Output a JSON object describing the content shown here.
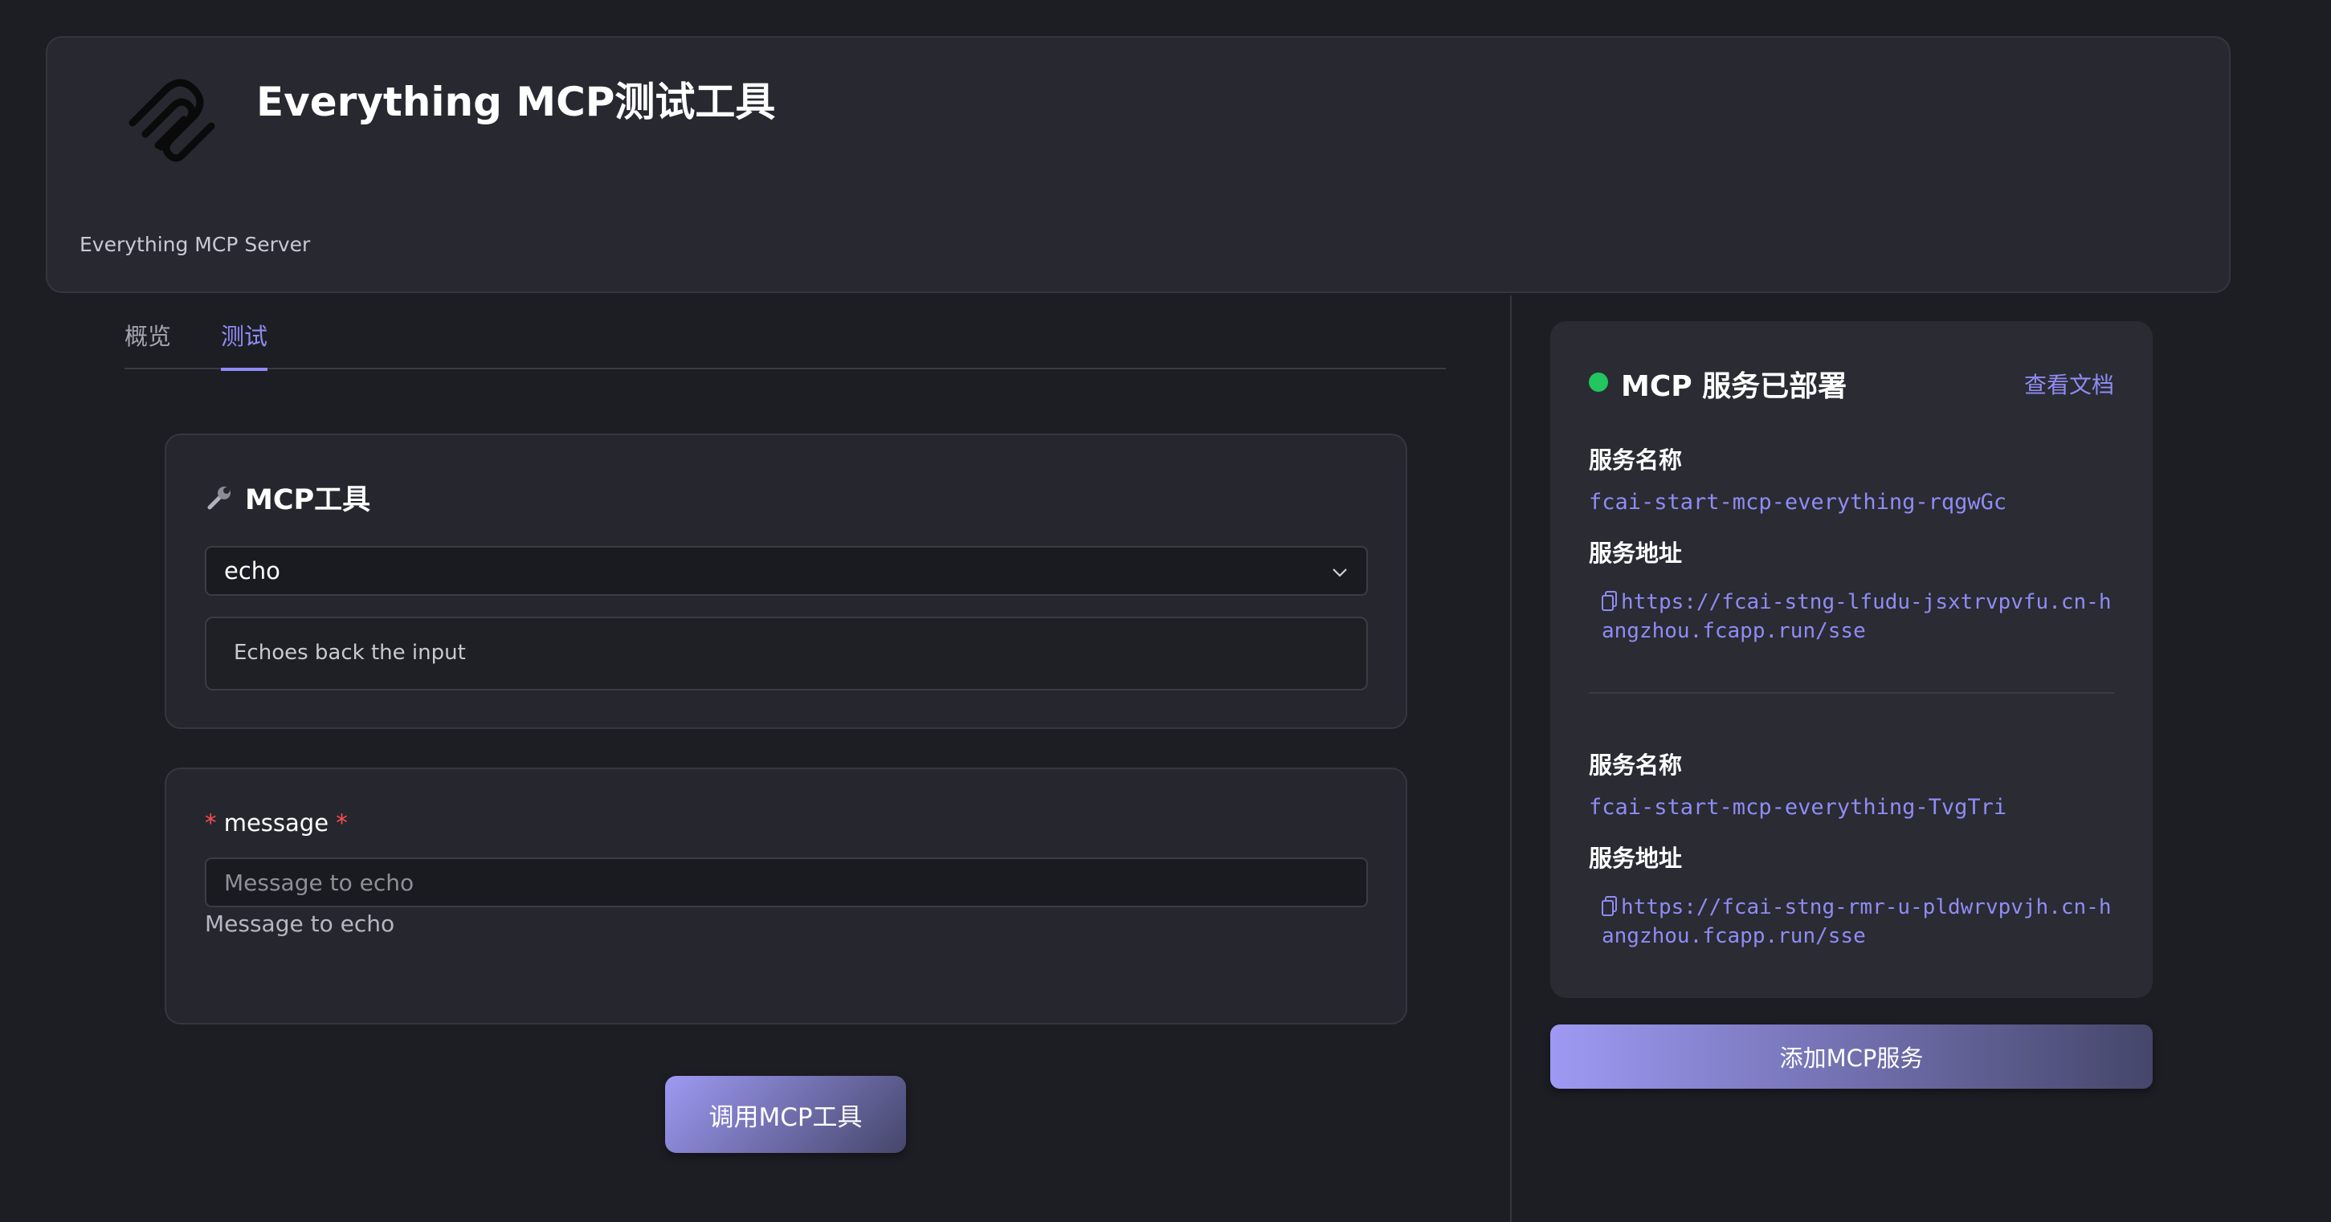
{
  "header": {
    "title": "Everything MCP测试工具",
    "server_label": "Everything MCP Server",
    "logo_icon": "mcp-logo-icon"
  },
  "tabs": [
    {
      "label": "概览",
      "active": false
    },
    {
      "label": "测试",
      "active": true
    }
  ],
  "tool_panel": {
    "title": "MCP工具",
    "title_icon": "wrench-icon",
    "selected_tool": "echo",
    "description": "Echoes back the input"
  },
  "params": {
    "label": "message",
    "required_mark": "*",
    "placeholder": "Message to echo",
    "value": "",
    "help": "Message to echo"
  },
  "invoke_button_label": "调用MCP工具",
  "service_card": {
    "status_text": "MCP 服务已部署",
    "status_color": "#22c55e",
    "docs_link": "查看文档",
    "services": [
      {
        "name_label": "服务名称",
        "name": "fcai-start-mcp-everything-rqgwGc",
        "url_label": "服务地址",
        "url": "https://fcai-stng-lfudu-jsxtrvpvfu.cn-hangzhou.fcapp.run/sse"
      },
      {
        "name_label": "服务名称",
        "name": "fcai-start-mcp-everything-TvgTri",
        "url_label": "服务地址",
        "url": "https://fcai-stng-rmr-u-pldwrvpvjh.cn-hangzhou.fcapp.run/sse"
      }
    ]
  },
  "add_service_label": "添加MCP服务",
  "colors": {
    "accent": "#8f8cf4",
    "background": "#1d1e24",
    "panel": "#26272e"
  }
}
